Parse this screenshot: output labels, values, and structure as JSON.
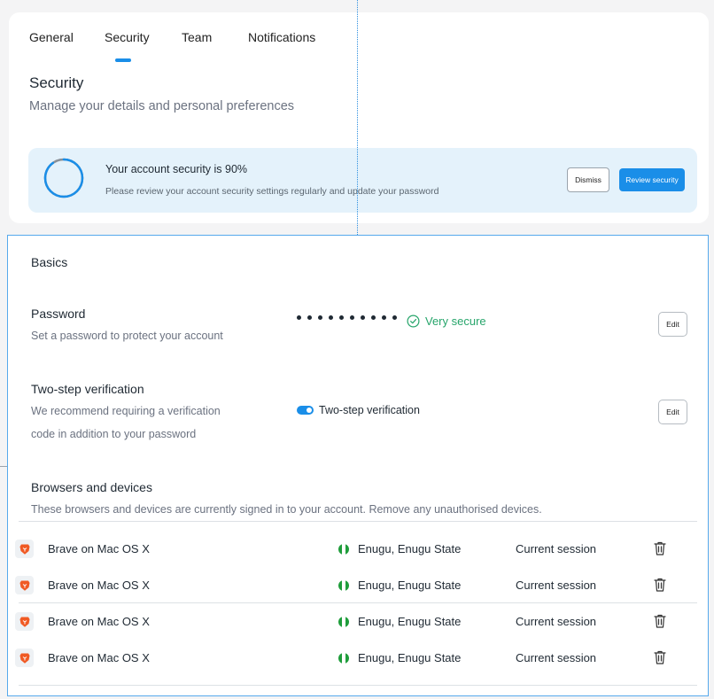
{
  "tabs": [
    {
      "label": "General"
    },
    {
      "label": "Security"
    },
    {
      "label": "Team"
    },
    {
      "label": "Notifications"
    }
  ],
  "active_tab": "Security",
  "page": {
    "title": "Security",
    "subtitle": "Manage your details and personal preferences"
  },
  "banner": {
    "title": "Your account security is 90%",
    "subtitle": "Please review your account security settings regularly and update your password",
    "security_score_percent": 90,
    "dismiss_label": "Dismiss",
    "review_label": "Review security"
  },
  "basics": {
    "title": "Basics"
  },
  "password": {
    "title": "Password",
    "description": "Set a password to protect your account",
    "masked_length": 10,
    "strength": "Very secure",
    "edit_label": "Edit"
  },
  "two_step": {
    "title": "Two-step verification",
    "description_line1": "We recommend requiring a verification",
    "description_line2": "code in addition to your password",
    "toggle_label": "Two-step verification",
    "enabled": true,
    "edit_label": "Edit"
  },
  "devices": {
    "title": "Browsers and devices",
    "description": "These browsers and devices are currently signed in to your account. Remove any unauthorised devices.",
    "items": [
      {
        "name": "Brave on Mac OS X",
        "location": "Enugu, Enugu State",
        "session": "Current session"
      },
      {
        "name": "Brave on Mac OS X",
        "location": "Enugu, Enugu State",
        "session": "Current session"
      },
      {
        "name": "Brave on Mac OS X",
        "location": "Enugu, Enugu State",
        "session": "Current session"
      },
      {
        "name": "Brave on Mac OS X",
        "location": "Enugu, Enugu State",
        "session": "Current session"
      }
    ]
  },
  "colors": {
    "accent": "#1a8ee8",
    "success": "#27a56b",
    "banner_bg": "#e4f2fb",
    "brave": "#f05a24",
    "flag_green": "#1f9d3b"
  },
  "icons": [
    "check-circle-icon",
    "brave-browser-icon",
    "nigeria-flag-icon",
    "trash-icon"
  ]
}
